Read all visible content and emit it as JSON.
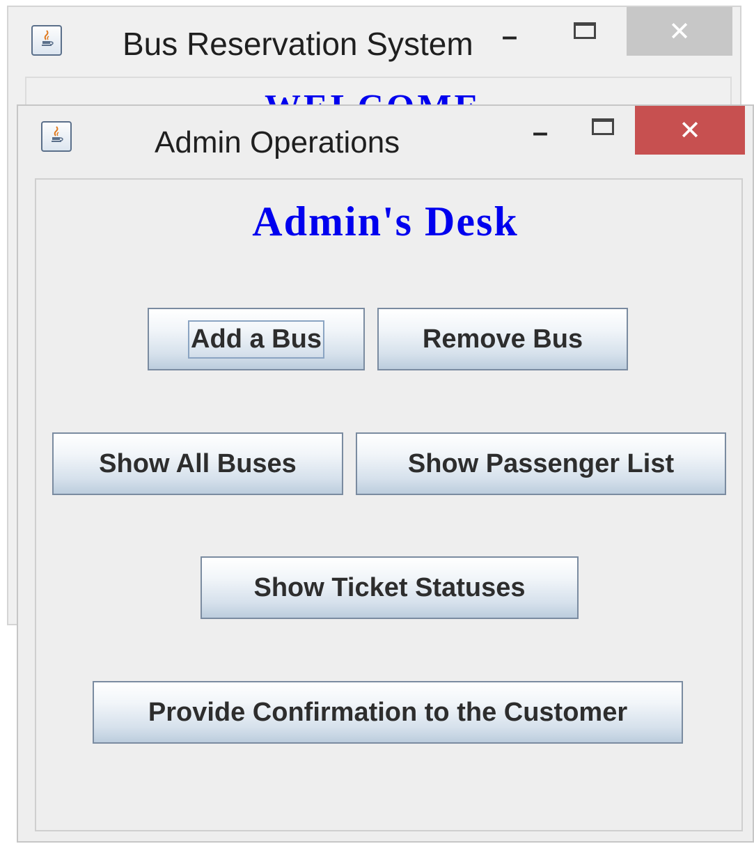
{
  "background_window": {
    "title": "Bus Reservation System",
    "icon": "java-coffee-icon",
    "minimize_glyph": "–",
    "close_glyph": "✕",
    "partial_heading": "WELCOME"
  },
  "foreground_window": {
    "title": "Admin Operations",
    "icon": "java-coffee-icon",
    "minimize_glyph": "–",
    "close_glyph": "✕",
    "heading": "Admin's Desk",
    "buttons": {
      "add_bus": "Add a Bus",
      "remove_bus": "Remove Bus",
      "show_all_buses": "Show All Buses",
      "show_passenger_list": "Show Passenger List",
      "show_ticket_statuses": "Show Ticket Statuses",
      "provide_confirmation": "Provide Confirmation to the Customer"
    }
  },
  "colors": {
    "heading_blue": "#0000ee",
    "close_active": "#c75050",
    "close_inactive": "#c7c7c7",
    "window_bg": "#eeeeee"
  }
}
